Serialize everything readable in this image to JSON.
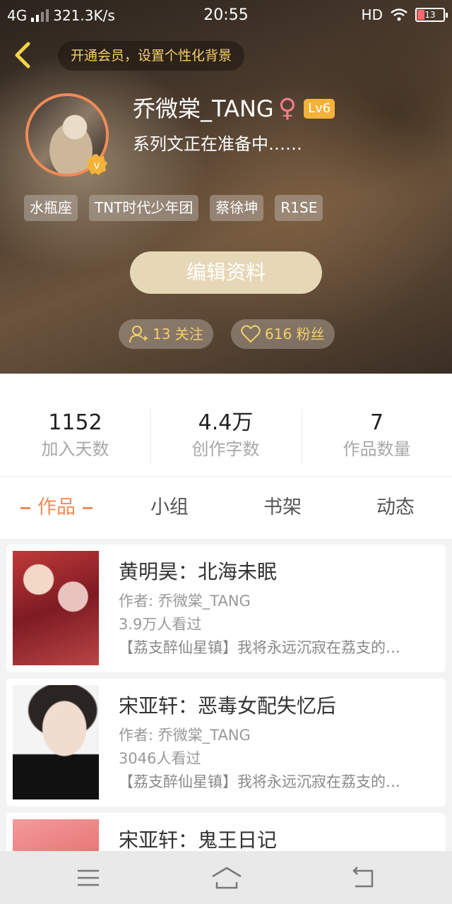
{
  "status_bar": {
    "network": "4G",
    "speed": "321.3K/s",
    "time": "20:55",
    "hd": "HD",
    "battery": "13"
  },
  "header": {
    "vip_banner": "开通会员，设置个性化背景",
    "username": "乔微棠_TANG",
    "gender_symbol": "♀",
    "level": "Lv6",
    "bio": "系列文正在准备中……",
    "tags": [
      "水瓶座",
      "TNT时代少年团",
      "蔡徐坤",
      "R1SE"
    ],
    "edit_button": "编辑资料",
    "following": "13 关注",
    "followers": "616 粉丝"
  },
  "stats": [
    {
      "value": "1152",
      "label": "加入天数"
    },
    {
      "value": "4.4万",
      "label": "创作字数"
    },
    {
      "value": "7",
      "label": "作品数量"
    }
  ],
  "tabs": {
    "works": "作品",
    "group": "小组",
    "bookshelf": "书架",
    "activity": "动态"
  },
  "works": [
    {
      "title": "黄明昊：北海未眠",
      "author": "作者: 乔微棠_TANG",
      "views": "3.9万人看过",
      "desc": "【荔支醉仙星镇】我将永远沉寂在荔支的…"
    },
    {
      "title": "宋亚轩：恶毒女配失忆后",
      "author": "作者: 乔微棠_TANG",
      "views": "3046人看过",
      "desc": "【荔支醉仙星镇】我将永远沉寂在荔支的…"
    },
    {
      "title": "宋亚轩：鬼王日记",
      "author": "",
      "views": "",
      "desc": ""
    }
  ],
  "colors": {
    "accent": "#f08b56",
    "gold": "#f5cf6a",
    "level_badge": "#f3b339"
  }
}
